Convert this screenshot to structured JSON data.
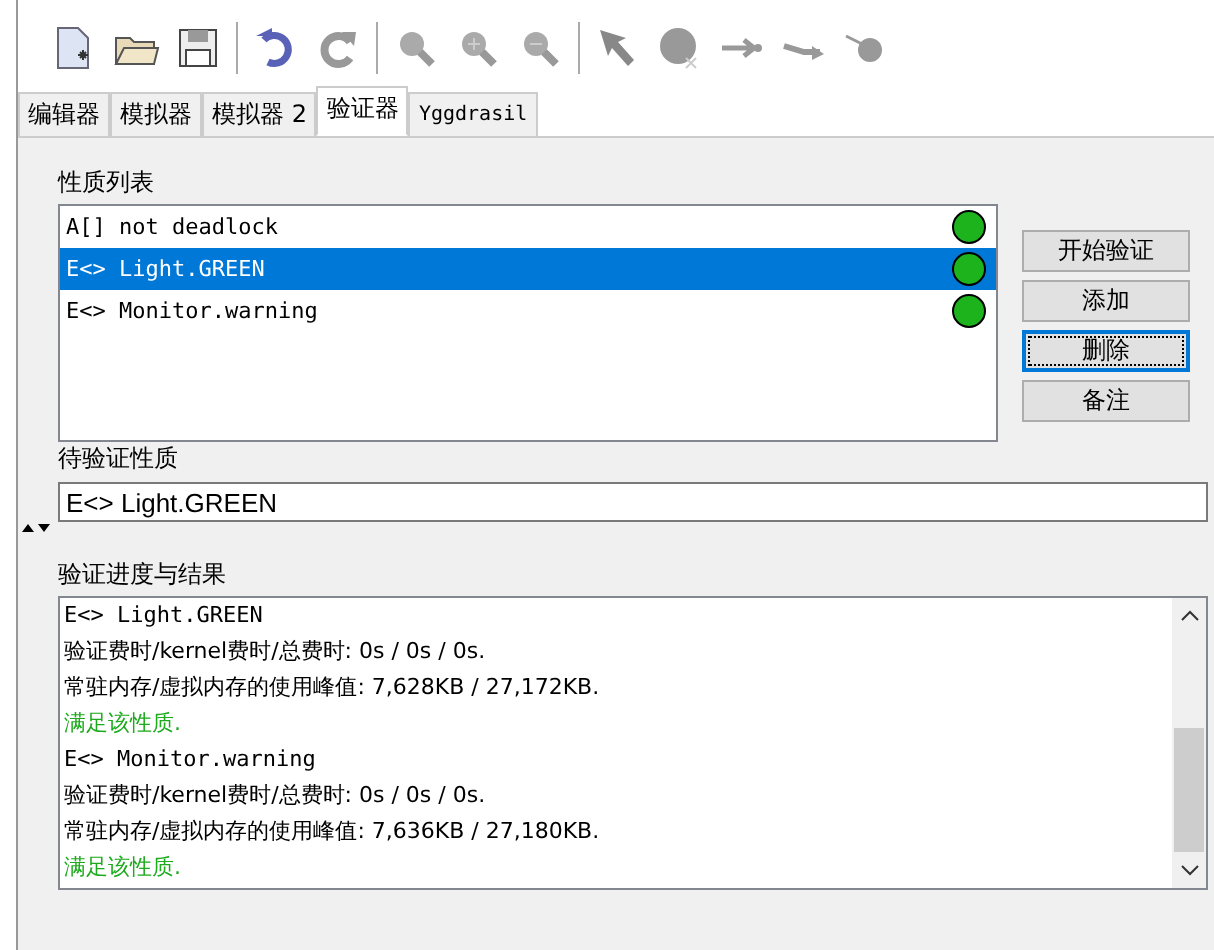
{
  "tabs": [
    {
      "label": "编辑器",
      "selected": false
    },
    {
      "label": "模拟器",
      "selected": false
    },
    {
      "label": "模拟器 2",
      "selected": false
    },
    {
      "label": "验证器",
      "selected": true
    },
    {
      "label": "Yggdrasil",
      "selected": false
    }
  ],
  "property_list": {
    "title": "性质列表",
    "items": [
      {
        "formula": "A[] not deadlock",
        "selected": false,
        "color": "#1db31d"
      },
      {
        "formula": "E<> Light.GREEN",
        "selected": true,
        "color": "#1db31d"
      },
      {
        "formula": "E<> Monitor.warning",
        "selected": false,
        "color": "#1db31d"
      }
    ]
  },
  "buttons": [
    {
      "label": "开始验证",
      "focused": false
    },
    {
      "label": "添加",
      "focused": false
    },
    {
      "label": "删除",
      "focused": true
    },
    {
      "label": "备注",
      "focused": false
    }
  ],
  "query": {
    "title": "待验证性质",
    "value": "E<> Light.GREEN"
  },
  "results": {
    "title": "验证进度与结果",
    "lines": [
      {
        "kind": "formula",
        "text": "E<> Light.GREEN"
      },
      {
        "kind": "info",
        "text": "验证费时/kernel费时/总费时: 0s / 0s / 0s."
      },
      {
        "kind": "info",
        "text": "常驻内存/虚拟内存的使用峰值: 7,628KB / 27,172KB."
      },
      {
        "kind": "ok",
        "text": "满足该性质."
      },
      {
        "kind": "formula",
        "text": "E<> Monitor.warning"
      },
      {
        "kind": "info",
        "text": "验证费时/kernel费时/总费时: 0s / 0s / 0s."
      },
      {
        "kind": "info",
        "text": "常驻内存/虚拟内存的使用峰值: 7,636KB / 27,180KB."
      },
      {
        "kind": "ok",
        "text": "满足该性质."
      }
    ]
  }
}
